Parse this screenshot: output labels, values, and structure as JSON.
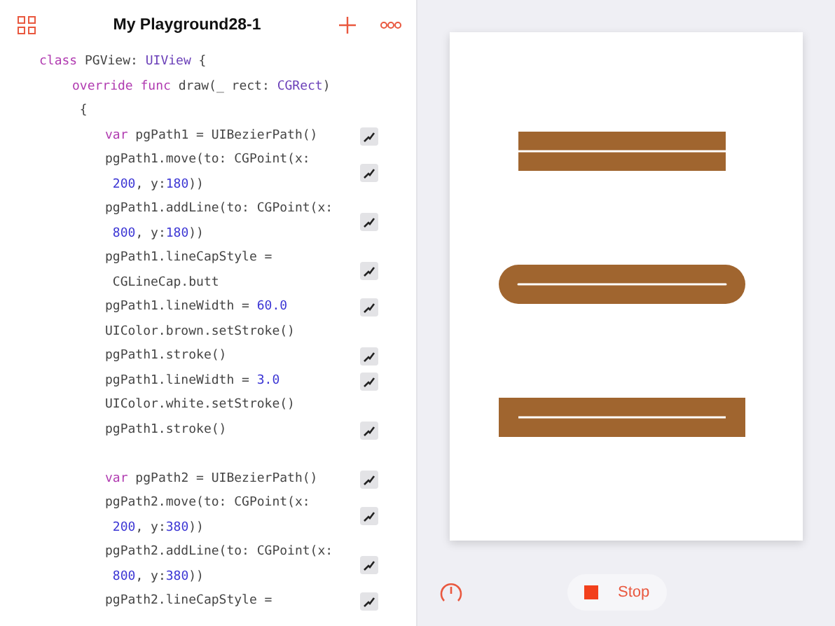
{
  "window": {
    "title": "My Playground28-1"
  },
  "code": [
    {
      "rows": [
        [
          {
            "kind": "keyword",
            "t": "class"
          },
          {
            "kind": "plain",
            "t": " PGView: "
          },
          {
            "kind": "type",
            "t": "UIView"
          },
          {
            "kind": "plain",
            "t": " {"
          }
        ]
      ],
      "result": false,
      "children": [
        {
          "rows": [
            [
              {
                "kind": "keyword",
                "t": "override func"
              },
              {
                "kind": "plain",
                "t": " draw(_ rect: "
              },
              {
                "kind": "type",
                "t": "CGRect"
              },
              {
                "kind": "plain",
                "t": ")"
              }
            ],
            [
              {
                "kind": "plain",
                "t": " {"
              }
            ]
          ],
          "result": false,
          "children": [
            {
              "rows": [
                [
                  {
                    "kind": "keyword",
                    "t": "var"
                  },
                  {
                    "kind": "plain",
                    "t": " pgPath1 = UIBezierPath()"
                  }
                ]
              ],
              "result": true
            },
            {
              "rows": [
                [
                  {
                    "kind": "plain",
                    "t": "pgPath1.move(to: CGPoint(x:"
                  }
                ],
                [
                  {
                    "kind": "number",
                    "t": " 200"
                  },
                  {
                    "kind": "plain",
                    "t": ", y:"
                  },
                  {
                    "kind": "number",
                    "t": "180"
                  },
                  {
                    "kind": "plain",
                    "t": "))"
                  }
                ]
              ],
              "result": true
            },
            {
              "rows": [
                [
                  {
                    "kind": "plain",
                    "t": "pgPath1.addLine(to: CGPoint(x:"
                  }
                ],
                [
                  {
                    "kind": "number",
                    "t": " 800"
                  },
                  {
                    "kind": "plain",
                    "t": ", y:"
                  },
                  {
                    "kind": "number",
                    "t": "180"
                  },
                  {
                    "kind": "plain",
                    "t": "))"
                  }
                ]
              ],
              "result": true
            },
            {
              "rows": [
                [
                  {
                    "kind": "plain",
                    "t": "pgPath1.lineCapStyle ="
                  }
                ],
                [
                  {
                    "kind": "plain",
                    "t": " CGLineCap.butt"
                  }
                ]
              ],
              "result": true
            },
            {
              "rows": [
                [
                  {
                    "kind": "plain",
                    "t": "pgPath1.lineWidth = "
                  },
                  {
                    "kind": "number",
                    "t": "60.0"
                  }
                ]
              ],
              "result": true
            },
            {
              "rows": [
                [
                  {
                    "kind": "plain",
                    "t": "UIColor.brown.setStroke()"
                  }
                ]
              ],
              "result": false
            },
            {
              "rows": [
                [
                  {
                    "kind": "plain",
                    "t": "pgPath1.stroke()"
                  }
                ]
              ],
              "result": true
            },
            {
              "rows": [
                [
                  {
                    "kind": "plain",
                    "t": "pgPath1.lineWidth = "
                  },
                  {
                    "kind": "number",
                    "t": "3.0"
                  }
                ]
              ],
              "result": true
            },
            {
              "rows": [
                [
                  {
                    "kind": "plain",
                    "t": "UIColor.white.setStroke()"
                  }
                ]
              ],
              "result": false
            },
            {
              "rows": [
                [
                  {
                    "kind": "plain",
                    "t": "pgPath1.stroke()"
                  }
                ]
              ],
              "result": true
            },
            {
              "kind": "blank"
            },
            {
              "rows": [
                [
                  {
                    "kind": "keyword",
                    "t": "var"
                  },
                  {
                    "kind": "plain",
                    "t": " pgPath2 = UIBezierPath()"
                  }
                ]
              ],
              "result": true
            },
            {
              "rows": [
                [
                  {
                    "kind": "plain",
                    "t": "pgPath2.move(to: CGPoint(x:"
                  }
                ],
                [
                  {
                    "kind": "number",
                    "t": " 200"
                  },
                  {
                    "kind": "plain",
                    "t": ", y:"
                  },
                  {
                    "kind": "number",
                    "t": "380"
                  },
                  {
                    "kind": "plain",
                    "t": "))"
                  }
                ]
              ],
              "result": true
            },
            {
              "rows": [
                [
                  {
                    "kind": "plain",
                    "t": "pgPath2.addLine(to: CGPoint(x:"
                  }
                ],
                [
                  {
                    "kind": "number",
                    "t": " 800"
                  },
                  {
                    "kind": "plain",
                    "t": ", y:"
                  },
                  {
                    "kind": "number",
                    "t": "380"
                  },
                  {
                    "kind": "plain",
                    "t": "))"
                  }
                ]
              ],
              "result": true
            },
            {
              "rows": [
                [
                  {
                    "kind": "plain",
                    "t": "pgPath2.lineCapStyle ="
                  }
                ]
              ],
              "result": true
            }
          ]
        }
      ]
    }
  ],
  "live_view": {
    "strokes": [
      {
        "kind": "butt"
      },
      {
        "kind": "round"
      },
      {
        "kind": "square"
      }
    ]
  },
  "stop_button": {
    "label": "Stop"
  }
}
